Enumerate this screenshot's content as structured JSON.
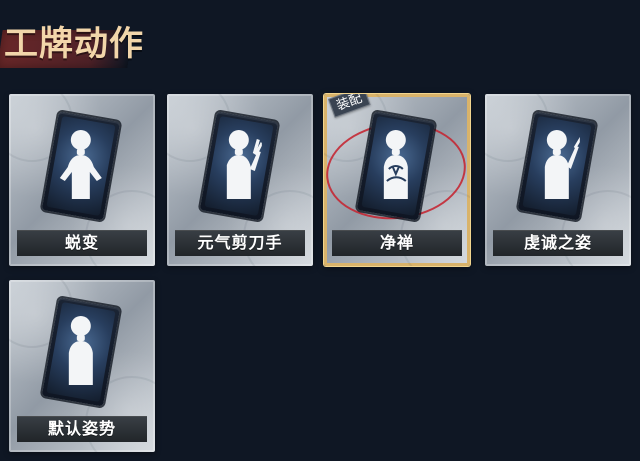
{
  "header": {
    "title": "工牌动作"
  },
  "cards": [
    {
      "name": "蜕变",
      "pose": "open-arms"
    },
    {
      "name": "元气剪刀手",
      "pose": "peace-sign"
    },
    {
      "name": "净禅",
      "pose": "meditate",
      "badge": "装配",
      "selected": true
    },
    {
      "name": "虔诚之姿",
      "pose": "raise-hand"
    },
    {
      "name": "默认姿势",
      "pose": "default"
    }
  ],
  "colors": {
    "background": "#0f1724",
    "title": "#f2d6aa",
    "title_band": "#6e2828",
    "selected_border": "#d9b36a",
    "selection_ring": "#c42834"
  }
}
